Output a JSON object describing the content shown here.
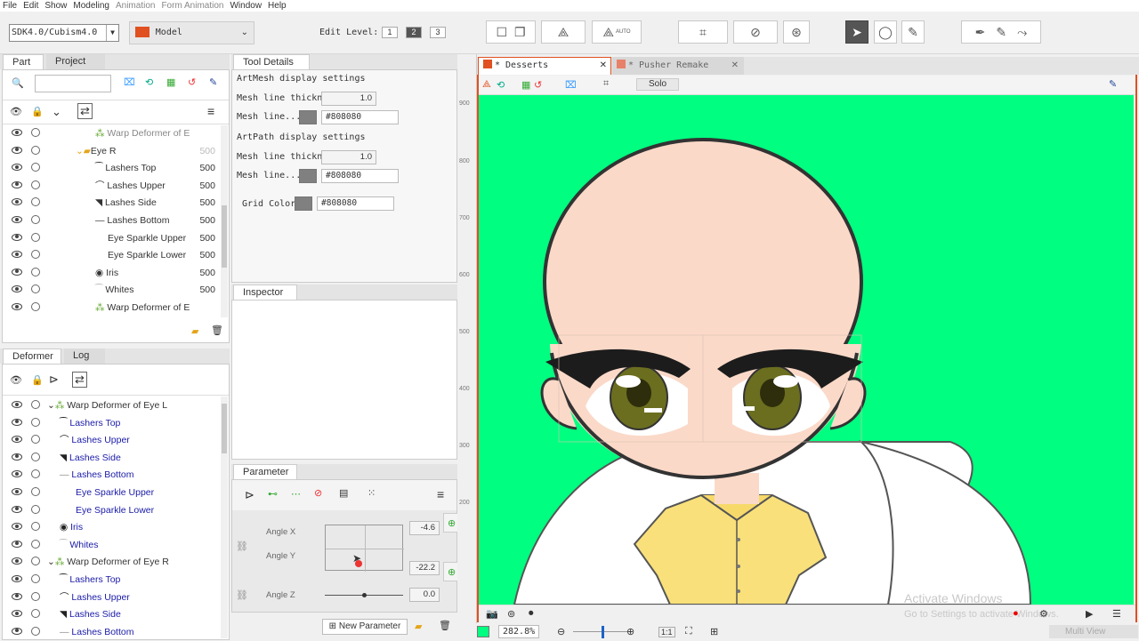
{
  "menu": [
    "File",
    "Edit",
    "Show",
    "Modeling",
    "Animation",
    "Form Animation",
    "Window",
    "Help"
  ],
  "toolbar": {
    "sdk_select": "SDK4.0/Cubism4.0",
    "mode_select": "Model",
    "edit_level_label": "Edit Level:",
    "levels": [
      "1",
      "2",
      "3"
    ],
    "selected_level": "2",
    "auto_label": "AUTO"
  },
  "part_panel": {
    "tabs": [
      "Part",
      "Project"
    ],
    "rows": [
      {
        "label": "Warp Deformer of E",
        "num": ""
      },
      {
        "label": "Eye R",
        "num": "500"
      },
      {
        "label": "Lashers Top",
        "num": "500"
      },
      {
        "label": "Lashes Upper",
        "num": "500"
      },
      {
        "label": "Lashes Side",
        "num": "500"
      },
      {
        "label": "Lashes Bottom",
        "num": "500"
      },
      {
        "label": "Eye Sparkle Upper",
        "num": "500"
      },
      {
        "label": "Eye Sparkle Lower",
        "num": "500"
      },
      {
        "label": "Iris",
        "num": "500"
      },
      {
        "label": "Whites",
        "num": "500"
      },
      {
        "label": "Warp Deformer of E",
        "num": ""
      }
    ]
  },
  "deformer_panel": {
    "tabs": [
      "Deformer",
      "Log"
    ],
    "rows": [
      "Warp Deformer of Eye L",
      "Lashers Top",
      "Lashes Upper",
      "Lashes Side",
      "Lashes Bottom",
      "Eye Sparkle Upper",
      "Eye Sparkle Lower",
      "Iris",
      "Whites",
      "Warp Deformer of Eye R",
      "Lashers Top",
      "Lashes Upper",
      "Lashes Side",
      "Lashes Bottom"
    ]
  },
  "tool_details": {
    "tab": "Tool Details",
    "artmesh_title": "ArtMesh display settings",
    "artpath_title": "ArtPath display settings",
    "mesh_thick_label": "Mesh line thickn...",
    "mesh_color_label": "Mesh line...",
    "thickness_value": "1.0",
    "color_value": "#808080",
    "grid_color_label": "Grid Color",
    "grid_color_value": "#808080"
  },
  "inspector": {
    "tab": "Inspector"
  },
  "parameter": {
    "tab": "Parameter",
    "angle_x_label": "Angle X",
    "angle_y_label": "Angle Y",
    "angle_z_label": "Angle Z",
    "angle_x_value": "-4.6",
    "angle_y_value": "-22.2",
    "angle_z_value": "0.0",
    "new_param_label": "New Parameter"
  },
  "viewer": {
    "tabs": [
      "* Desserts",
      "* Pusher Remake"
    ],
    "solo_label": "Solo",
    "ruler": [
      "900",
      "800",
      "700",
      "600",
      "500",
      "400",
      "300",
      "200"
    ],
    "zoom": "282.8",
    "ratio": "1:1",
    "watermark1": "Activate Windows",
    "watermark2": "Go to Settings to activate Windows.",
    "multi_view": "Multi View"
  },
  "colors": {
    "canvas_bg": "#00ff80",
    "accent": "#e05020",
    "deformer_text": "#1a1aa8"
  }
}
